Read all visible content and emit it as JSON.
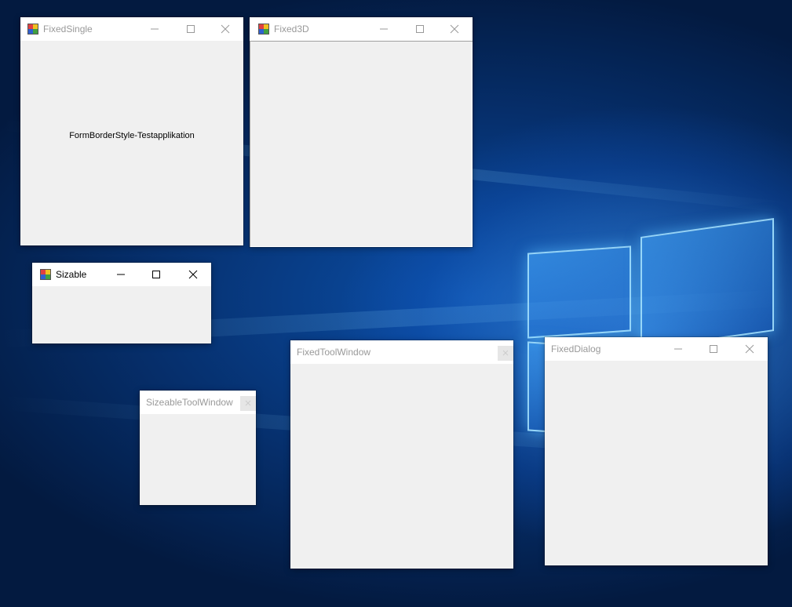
{
  "desktop": {
    "background": "Windows 10 hero wallpaper",
    "accent": "#0b4fa8"
  },
  "windows": {
    "fixed_single": {
      "title": "FixedSingle",
      "label": "FormBorderStyle-Testapplikation",
      "active": false
    },
    "fixed_3d": {
      "title": "Fixed3D",
      "active": false
    },
    "sizable": {
      "title": "Sizable",
      "active": true
    },
    "sizeable_tool": {
      "title": "SizeableToolWindow",
      "active": false
    },
    "fixed_tool": {
      "title": "FixedToolWindow",
      "active": false
    },
    "fixed_dialog": {
      "title": "FixedDialog",
      "active": false
    }
  },
  "icons": {
    "app": "winforms-app-icon",
    "minimize": "minimize-icon",
    "maximize": "maximize-icon",
    "close": "close-icon"
  },
  "colors": {
    "client_bg": "#f0f0f0",
    "titlebar_bg": "#ffffff",
    "inactive_title": "#999999",
    "active_title": "#000000"
  }
}
